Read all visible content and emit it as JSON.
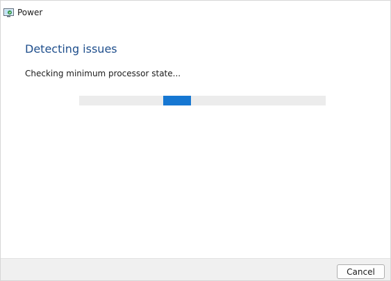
{
  "window": {
    "title": "Power",
    "icon": "troubleshooter-app-icon"
  },
  "main": {
    "heading": "Detecting issues",
    "status": "Checking minimum processor state...",
    "progress": {
      "mode": "indeterminate",
      "color": "#1677d2",
      "track_color": "#ececec"
    }
  },
  "footer": {
    "cancel_label": "Cancel"
  },
  "colors": {
    "heading": "#1e4e8c",
    "footer_bg": "#f0f0f0"
  }
}
